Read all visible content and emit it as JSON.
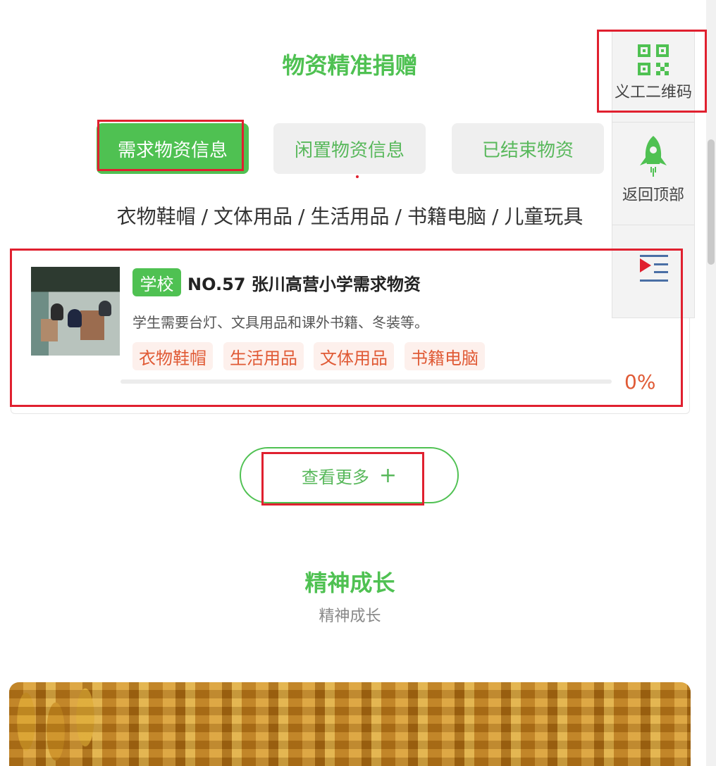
{
  "section1": {
    "title": "物资精准捐赠",
    "tabs": [
      "需求物资信息",
      "闲置物资信息",
      "已结束物资"
    ],
    "active_tab": 0,
    "categories": [
      "衣物鞋帽",
      "文体用品",
      "生活用品",
      "书籍电脑",
      "儿童玩具"
    ],
    "separator": "/"
  },
  "card": {
    "badge": "学校",
    "title": "NO.57 张川高营小学需求物资",
    "description": "学生需要台灯、文具用品和课外书籍、冬装等。",
    "tags": [
      "衣物鞋帽",
      "生活用品",
      "文体用品",
      "书籍电脑"
    ],
    "progress_percent": 0,
    "progress_label": "0%"
  },
  "more_button": {
    "label": "查看更多",
    "icon": "plus-icon"
  },
  "section2": {
    "title": "精神成长",
    "subtitle": "精神成长"
  },
  "side_panel": {
    "qr_label": "义工二维码",
    "qr_icon": "qr-code-icon",
    "top_label": "返回顶部",
    "top_icon": "rocket-icon",
    "menu_icon": "menu-toggle-icon"
  },
  "colors": {
    "accent": "#4fc152",
    "tag_text": "#e05a35",
    "tag_bg": "#fdf0ec",
    "highlight": "#e0202f"
  }
}
